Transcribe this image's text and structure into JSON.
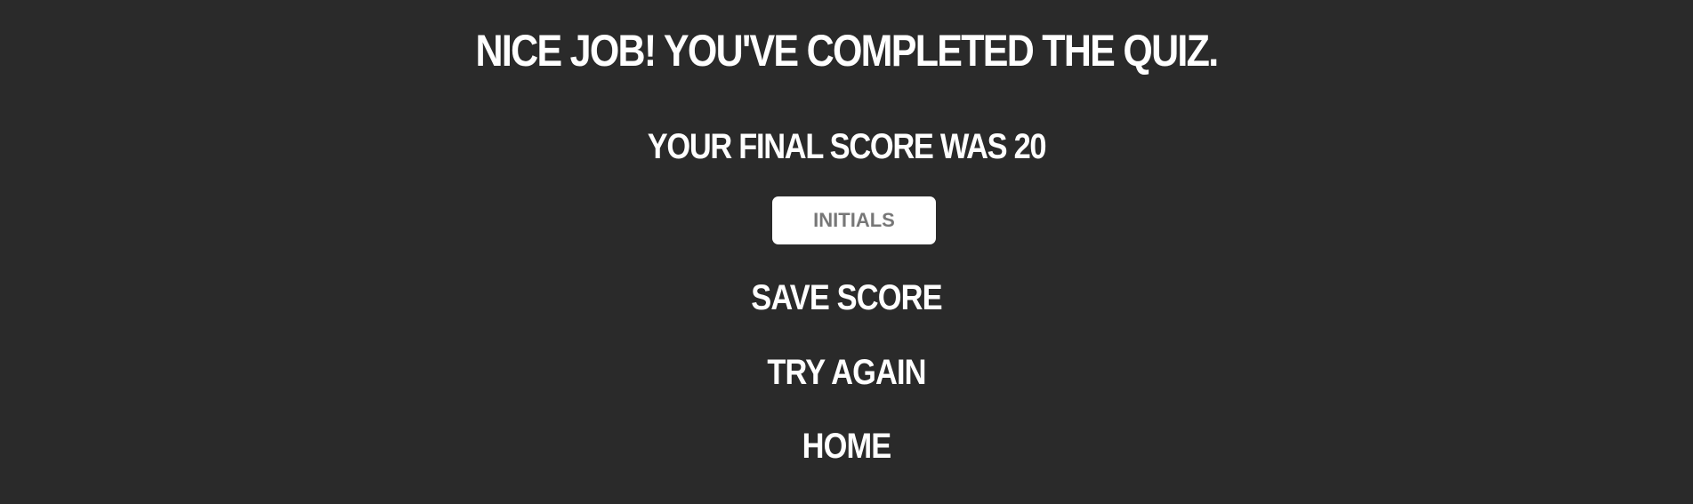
{
  "quiz_complete": {
    "title": "NICE JOB! YOU'VE COMPLETED THE QUIZ.",
    "score_text": "YOUR FINAL SCORE WAS 20",
    "initials_placeholder": "INITIALS",
    "save_label": "SAVE SCORE",
    "retry_label": "TRY AGAIN",
    "home_label": "HOME"
  },
  "colors": {
    "background": "#2a2a2a",
    "text": "#ffffff",
    "input_background": "#ffffff",
    "placeholder": "#777777"
  }
}
